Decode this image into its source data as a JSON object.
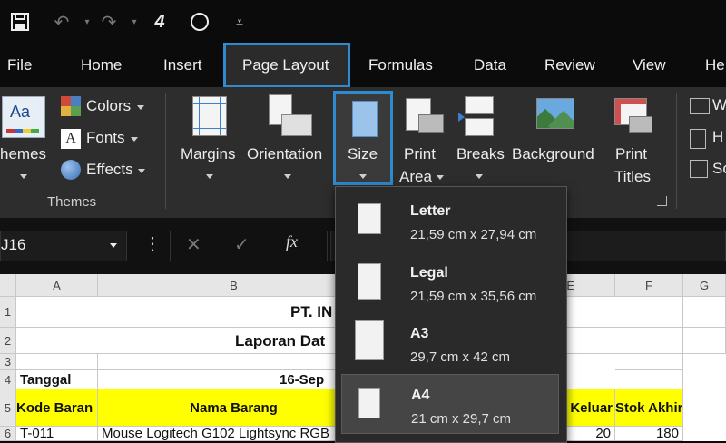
{
  "quick_access": {
    "icons": [
      "save-icon",
      "undo-icon",
      "redo-icon",
      "touch-mode-icon",
      "circle-icon",
      "customize-icon"
    ]
  },
  "tabs": [
    "File",
    "Home",
    "Insert",
    "Page Layout",
    "Formulas",
    "Data",
    "Review",
    "View",
    "He"
  ],
  "active_tab": "Page Layout",
  "ribbon": {
    "themes_group": {
      "themes_label": "hemes",
      "colors": "Colors",
      "fonts": "Fonts",
      "effects": "Effects",
      "group_label": "Themes",
      "colors_swatch": [
        "#d04a3a",
        "#4a7fc0",
        "#e0b040",
        "#5aa050"
      ]
    },
    "page_setup": {
      "margins": "Margins",
      "orientation": "Orientation",
      "size": "Size",
      "print_area_1": "Print",
      "print_area_2": "Area",
      "breaks": "Breaks",
      "background": "Background",
      "print_titles_1": "Print",
      "print_titles_2": "Titles"
    },
    "scale_partial": [
      "W",
      "H",
      "So"
    ]
  },
  "formula_bar": {
    "name_box": "J16",
    "fx": "fx"
  },
  "grid": {
    "columns": [
      "A",
      "B",
      "E",
      "F",
      "G"
    ],
    "rows": [
      "1",
      "2",
      "3",
      "4",
      "5",
      "6"
    ],
    "title1": "PT. IN",
    "title2": "Laporan Dat",
    "tanggal_label": "Tanggal",
    "tanggal_value": "16-Sep",
    "header_kode": "Kode Baran",
    "header_nama": "Nama Barang",
    "header_keluar": "g Keluar",
    "header_akhir": "Stok Akhir",
    "row6_kode": "T-011",
    "row6_nama": "Mouse Logitech G102 Lightsync RGB",
    "row6_keluar": "20",
    "row6_akhir": "180"
  },
  "size_dropdown": [
    {
      "name": "Letter",
      "dims": "21,59 cm x 27,94 cm"
    },
    {
      "name": "Legal",
      "dims": "21,59 cm x 35,56 cm"
    },
    {
      "name": "A3",
      "dims": "29,7 cm x 42 cm"
    },
    {
      "name": "A4",
      "dims": "21 cm x 29,7 cm"
    }
  ],
  "selected_size": "A4",
  "colors": {
    "accent": "#2f8ad0",
    "ribbon_bg": "#2d2d2d",
    "header_yellow": "#ffff00"
  }
}
